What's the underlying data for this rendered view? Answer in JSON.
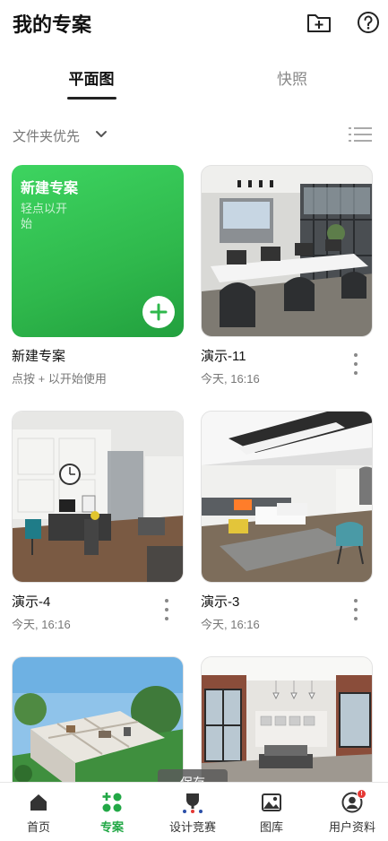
{
  "header": {
    "title": "我的专案",
    "new_folder_icon": "folder-plus-icon",
    "help_icon": "help-circle-icon"
  },
  "tabs": [
    {
      "label": "平面图",
      "active": true
    },
    {
      "label": "快照",
      "active": false
    }
  ],
  "sort": {
    "label": "文件夹优先",
    "chevron_icon": "chevron-down-icon",
    "view_icon": "list-view-icon"
  },
  "new_project": {
    "tile_title": "新建专案",
    "tile_hint": "轻点以开始",
    "title": "新建专案",
    "subtitle": "点按 + 以开始使用",
    "accent": "#2fb84c"
  },
  "projects": [
    {
      "name": "演示-11",
      "time": "今天, 16:16"
    },
    {
      "name": "演示-4",
      "time": "今天, 16:16"
    },
    {
      "name": "演示-3",
      "time": "今天, 16:16"
    }
  ],
  "toast": "保存",
  "bottom_nav": [
    {
      "label": "首页",
      "icon": "home-icon",
      "active": false
    },
    {
      "label": "专案",
      "icon": "projects-grid-icon",
      "active": true
    },
    {
      "label": "设计竞赛",
      "icon": "trophy-icon",
      "active": false
    },
    {
      "label": "图库",
      "icon": "gallery-icon",
      "active": false
    },
    {
      "label": "用户资料",
      "icon": "user-profile-icon",
      "active": false,
      "badge": "!"
    }
  ],
  "colors": {
    "brand_green": "#22a846",
    "badge_red": "#e53935"
  }
}
